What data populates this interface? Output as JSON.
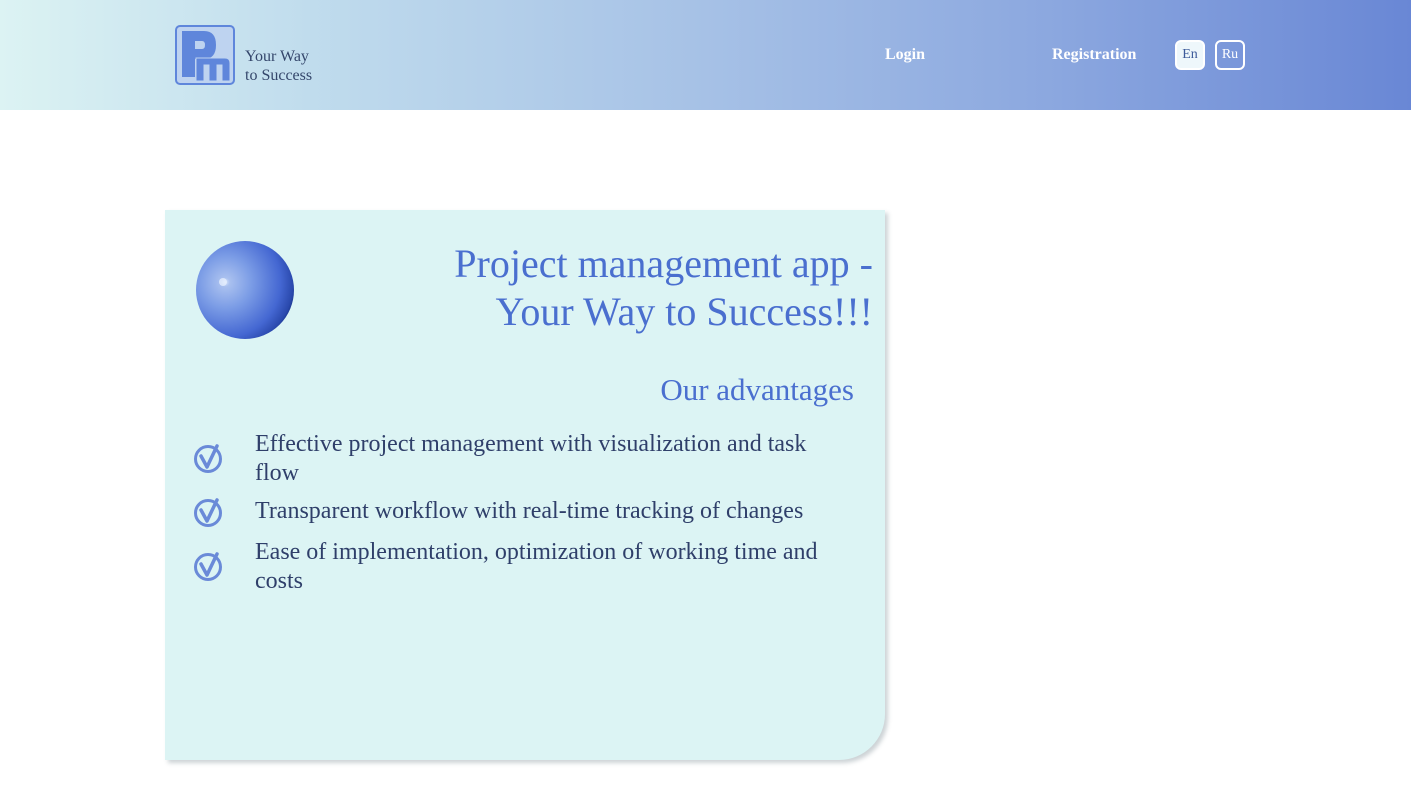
{
  "header": {
    "tagline_line1": "Your Way",
    "tagline_line2": "to Success",
    "nav": {
      "login": "Login",
      "registration": "Registration"
    },
    "languages": {
      "en": "En",
      "ru": "Ru",
      "selected": "En"
    }
  },
  "card": {
    "title_line1": "Project management app -",
    "title_line2": "Your Way to Success!!!",
    "advantages_title": "Our advantages",
    "advantages": [
      "Effective project management with visualization and task flow",
      "Transparent workflow with real-time tracking of changes",
      "Ease of implementation, optimization of working time and costs"
    ]
  },
  "colors": {
    "accent": "#4a6fcf",
    "card_background": "#dcf4f4",
    "header_gradient_start": "#dcf3f3",
    "header_gradient_end": "#6987d5",
    "body_text": "#2f3f6a"
  },
  "icons": {
    "logo": "pm-logo-icon",
    "sphere": "blue-sphere-icon",
    "check": "check-circle-icon"
  }
}
